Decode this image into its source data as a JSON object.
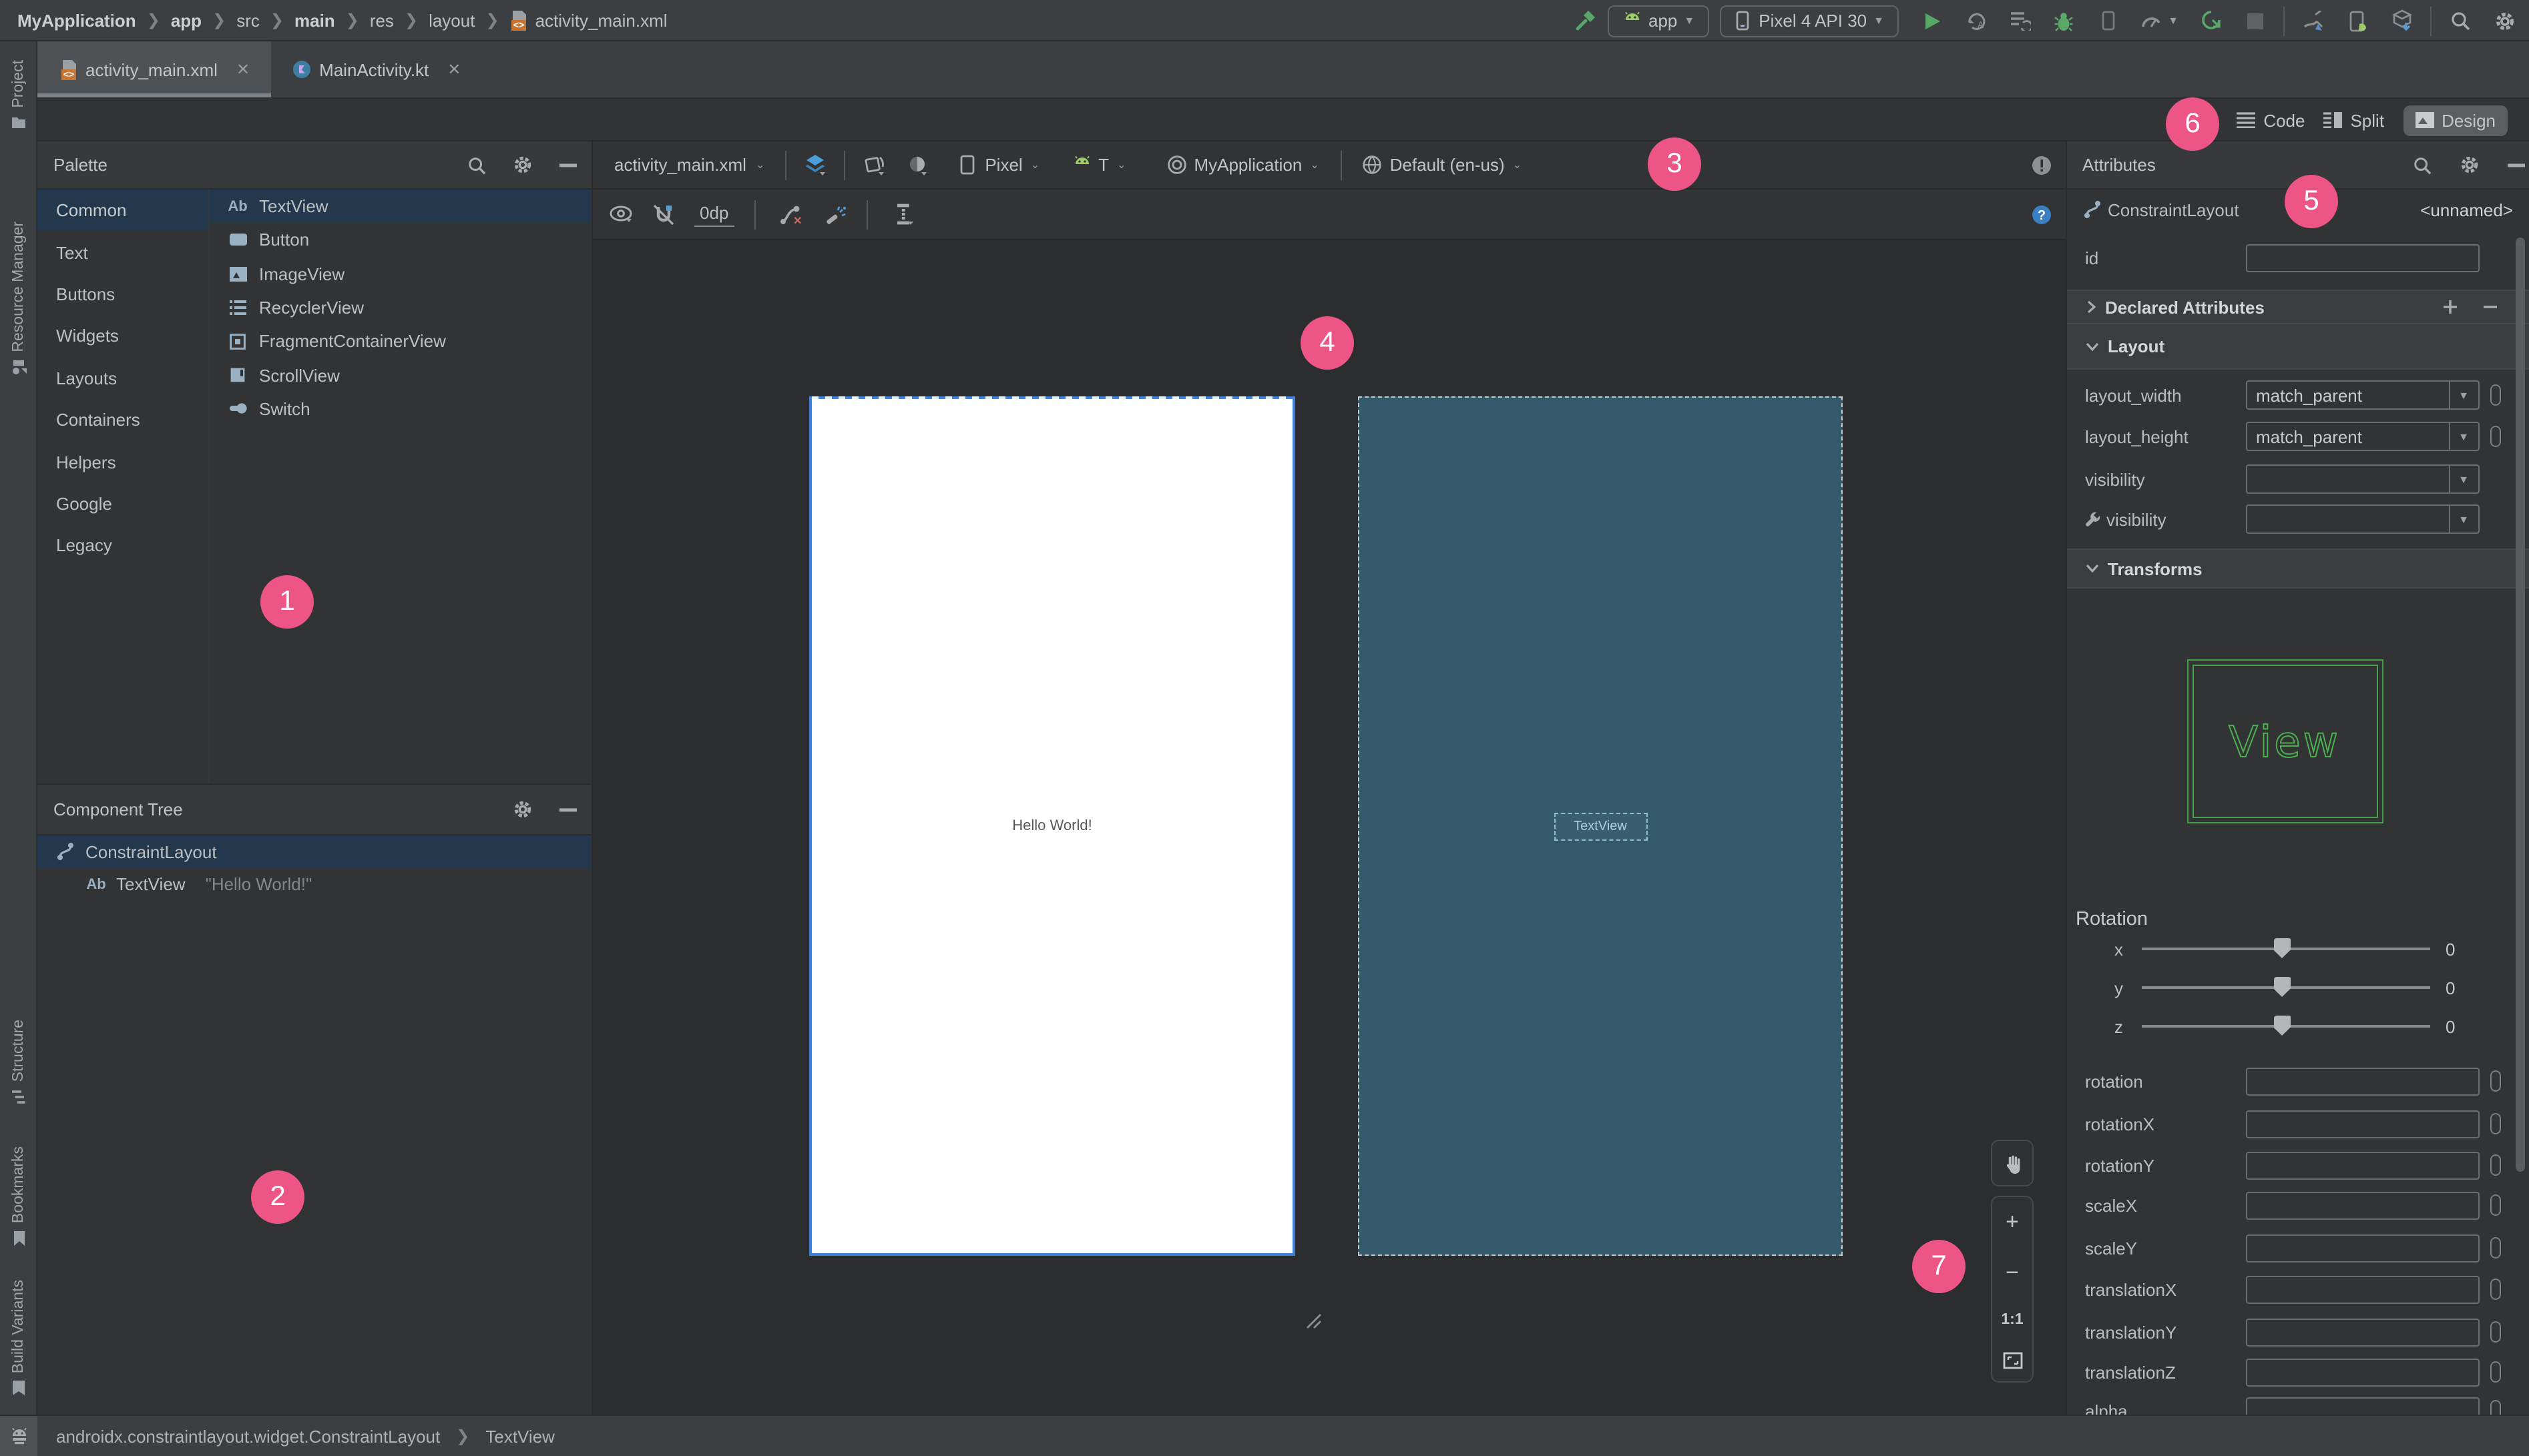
{
  "breadcrumb": {
    "segments": [
      {
        "label": "MyApplication",
        "bold": true
      },
      {
        "label": "app",
        "bold": true
      },
      {
        "label": "src",
        "bold": false
      },
      {
        "label": "main",
        "bold": true
      },
      {
        "label": "res",
        "bold": false
      },
      {
        "label": "layout",
        "bold": false
      },
      {
        "label": "activity_main.xml",
        "bold": false,
        "icon": "xml-file"
      }
    ]
  },
  "run_toolbar": {
    "config": "app",
    "device": "Pixel 4 API 30"
  },
  "tabs": [
    {
      "label": "activity_main.xml",
      "icon": "xml-file",
      "selected": true
    },
    {
      "label": "MainActivity.kt",
      "icon": "kotlin-file",
      "selected": false
    }
  ],
  "editor_modes": {
    "code": "Code",
    "split": "Split",
    "design": "Design",
    "selected": "Design"
  },
  "stripe_left": {
    "project": "Project",
    "resource_manager": "Resource Manager",
    "structure": "Structure",
    "bookmarks": "Bookmarks",
    "build_variants": "Build Variants"
  },
  "palette": {
    "title": "Palette",
    "categories": [
      {
        "label": "Common",
        "selected": true
      },
      {
        "label": "Text"
      },
      {
        "label": "Buttons"
      },
      {
        "label": "Widgets"
      },
      {
        "label": "Layouts"
      },
      {
        "label": "Containers"
      },
      {
        "label": "Helpers"
      },
      {
        "label": "Google"
      },
      {
        "label": "Legacy"
      }
    ],
    "items": [
      {
        "label": "TextView",
        "icon": "textview",
        "selected": true
      },
      {
        "label": "Button",
        "icon": "button"
      },
      {
        "label": "ImageView",
        "icon": "imageview"
      },
      {
        "label": "RecyclerView",
        "icon": "recyclerview"
      },
      {
        "label": "FragmentContainerView",
        "icon": "fragment"
      },
      {
        "label": "ScrollView",
        "icon": "scrollview"
      },
      {
        "label": "Switch",
        "icon": "switch"
      }
    ]
  },
  "component_tree": {
    "title": "Component Tree",
    "rows": [
      {
        "label": "ConstraintLayout",
        "icon": "constraintlayout",
        "selected": true
      },
      {
        "label": "TextView",
        "detail": "\"Hello World!\"",
        "icon": "textview",
        "selected": false
      }
    ]
  },
  "design_toolbar": {
    "file": "activity_main.xml",
    "device": "Pixel",
    "api_level": "T",
    "theme": "MyApplication",
    "locale": "Default (en-us)",
    "margin": "0dp"
  },
  "canvas": {
    "design_text": "Hello World!",
    "blueprint_label": "TextView",
    "zoom_in": "+",
    "zoom_out": "−",
    "zoom_ratio": "1:1"
  },
  "attributes": {
    "title": "Attributes",
    "component": "ConstraintLayout",
    "component_id": "<unnamed>",
    "id_label": "id",
    "id_value": "",
    "sections": {
      "declared": "Declared Attributes",
      "layout": "Layout",
      "transforms": "Transforms"
    },
    "rows": [
      {
        "label": "layout_width",
        "value": "match_parent"
      },
      {
        "label": "layout_height",
        "value": "match_parent"
      },
      {
        "label": "visibility",
        "value": ""
      },
      {
        "label": "visibility",
        "value": "",
        "wrench": true
      },
      {
        "label": "rotation",
        "value": ""
      },
      {
        "label": "rotationX",
        "value": ""
      },
      {
        "label": "rotationY",
        "value": ""
      },
      {
        "label": "scaleX",
        "value": ""
      },
      {
        "label": "scaleY",
        "value": ""
      },
      {
        "label": "translationX",
        "value": ""
      },
      {
        "label": "translationY",
        "value": ""
      },
      {
        "label": "translationZ",
        "value": ""
      },
      {
        "label": "alpha",
        "value": ""
      }
    ],
    "transforms_preview": "View",
    "rotation": {
      "label": "Rotation",
      "axes": [
        {
          "axis": "x",
          "value": "0"
        },
        {
          "axis": "y",
          "value": "0"
        },
        {
          "axis": "z",
          "value": "0"
        }
      ]
    }
  },
  "status_bar": {
    "path": "androidx.constraintlayout.widget.ConstraintLayout",
    "node": "TextView"
  },
  "annotations": {
    "n1": "1",
    "n2": "2",
    "n3": "3",
    "n4": "4",
    "n5": "5",
    "n6": "6",
    "n7": "7"
  },
  "colors": {
    "accent_pink": "#ec5586",
    "selection_blue": "#24384d",
    "blueprint_teal": "#33596b",
    "android_green": "#9ccc65",
    "design_border_blue": "#3d7fd9",
    "view_green": "#4caf50"
  }
}
